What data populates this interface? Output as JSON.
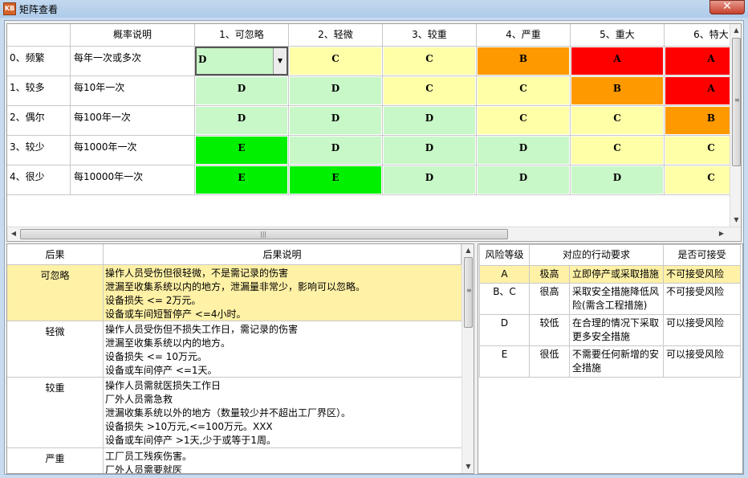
{
  "window": {
    "title": "矩阵查看",
    "icon_text": "KB",
    "close_glyph": "✕"
  },
  "matrix": {
    "prob_header": "概率说明",
    "columns": [
      "1、可忽略",
      "2、轻微",
      "3、较重",
      "4、严重",
      "5、重大",
      "6、特大"
    ],
    "rows": [
      {
        "label": "0、频繁",
        "prob": "每年一次或多次",
        "levels": [
          "D",
          "C",
          "C",
          "B",
          "A",
          "A"
        ]
      },
      {
        "label": "1、较多",
        "prob": "每10年一次",
        "levels": [
          "D",
          "D",
          "C",
          "C",
          "B",
          "A"
        ]
      },
      {
        "label": "2、偶尔",
        "prob": "每100年一次",
        "levels": [
          "D",
          "D",
          "D",
          "C",
          "C",
          "B"
        ]
      },
      {
        "label": "3、较少",
        "prob": "每1000年一次",
        "levels": [
          "E",
          "D",
          "D",
          "D",
          "C",
          "C"
        ]
      },
      {
        "label": "4、很少",
        "prob": "每10000年一次",
        "levels": [
          "E",
          "E",
          "D",
          "D",
          "D",
          "C"
        ]
      }
    ],
    "cell_colors": [
      [
        "#c8f7c8",
        "#ffffa8",
        "#ffffa8",
        "#ff9900",
        "#ff0000",
        "#ff0000"
      ],
      [
        "#c8f7c8",
        "#c8f7c8",
        "#ffffa8",
        "#ffffa8",
        "#ff9900",
        "#ff0000"
      ],
      [
        "#c8f7c8",
        "#c8f7c8",
        "#c8f7c8",
        "#ffffa8",
        "#ffffa8",
        "#ff9900"
      ],
      [
        "#00f000",
        "#c8f7c8",
        "#c8f7c8",
        "#c8f7c8",
        "#ffffa8",
        "#ffffa8"
      ],
      [
        "#00f000",
        "#00f000",
        "#c8f7c8",
        "#c8f7c8",
        "#c8f7c8",
        "#ffffa8"
      ]
    ]
  },
  "consequences": {
    "headers": [
      "后果",
      "后果说明"
    ],
    "items": [
      {
        "name": "可忽略",
        "lines": [
          "操作人员受伤但很轻微，不是需记录的伤害",
          "泄漏至收集系统以内的地方，泄漏量非常少，影响可以忽略。",
          "设备损失 <= 2万元。",
          "设备或车间短暂停产 <=4小时。"
        ]
      },
      {
        "name": "轻微",
        "lines": [
          "操作人员受伤但不损失工作日，需记录的伤害",
          "泄漏至收集系统以内的地方。",
          "设备损失 <= 10万元。",
          "设备或车间停产 <=1天。"
        ]
      },
      {
        "name": "较重",
        "lines": [
          "操作人员需就医损失工作日",
          "厂外人员需急救",
          "泄漏收集系统以外的地方（数量较少并不超出工厂界区）。",
          "设备损失 >10万元,<=100万元。XXX",
          "设备或车间停产 >1天,少于或等于1周。"
        ]
      },
      {
        "name": "严重",
        "lines": [
          "工厂员工残疾伤害。",
          "厂外人员需要就医"
        ]
      }
    ]
  },
  "actions": {
    "headers": [
      "风险等级",
      "对应的行动要求",
      "是否可接受"
    ],
    "items": [
      {
        "level": "A",
        "degree": "极高",
        "action": "立即停产或采取措施",
        "acceptable": "不可接受风险"
      },
      {
        "level": "B、C",
        "degree": "很高",
        "action": "采取安全措施降低风险(需含工程措施)",
        "acceptable": "不可接受风险"
      },
      {
        "level": "D",
        "degree": "较低",
        "action": "在合理的情况下采取更多安全措施",
        "acceptable": "可以接受风险"
      },
      {
        "level": "E",
        "degree": "很低",
        "action": "不需要任何新增的安全措施",
        "acceptable": "可以接受风险"
      }
    ]
  },
  "scroll_glyphs": {
    "up": "▲",
    "down": "▼",
    "left": "◀",
    "right": "▶",
    "grip_v": "≡",
    "grip_h": "|||"
  }
}
